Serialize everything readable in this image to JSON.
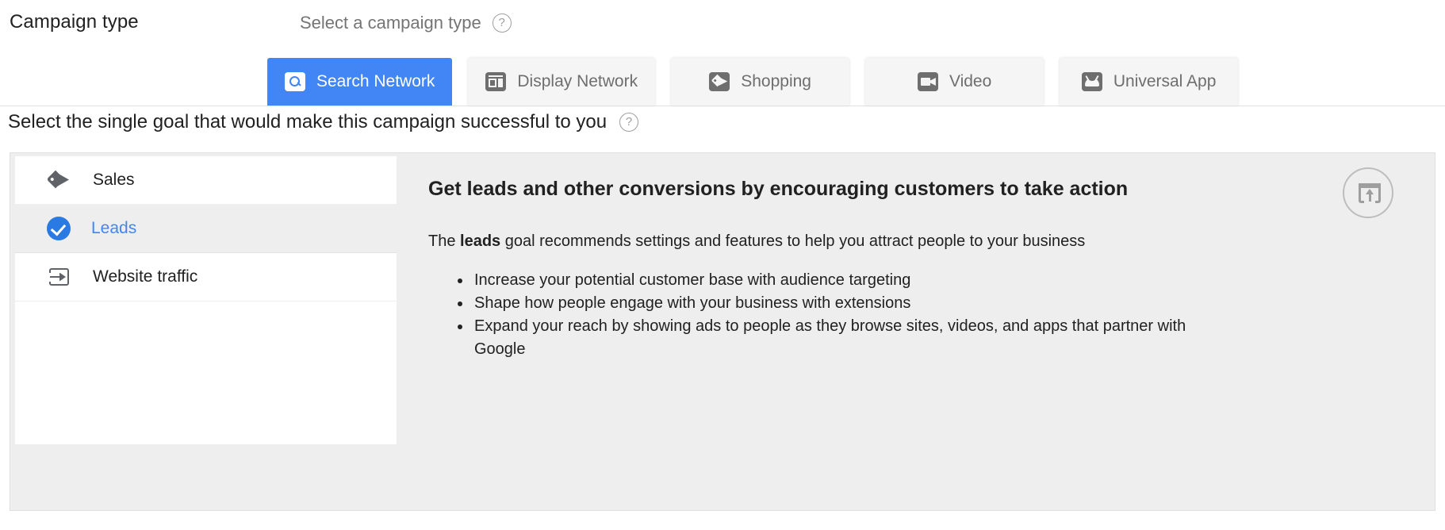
{
  "campaign_type": {
    "label": "Campaign type",
    "subtitle": "Select a campaign type",
    "help_icon": "help-circle-icon",
    "tabs": [
      {
        "label": "Search Network",
        "icon": "search-icon",
        "active": true
      },
      {
        "label": "Display Network",
        "icon": "display-network-icon",
        "active": false
      },
      {
        "label": "Shopping",
        "icon": "price-tag-icon",
        "active": false
      },
      {
        "label": "Video",
        "icon": "video-camera-icon",
        "active": false
      },
      {
        "label": "Universal App",
        "icon": "android-app-icon",
        "active": false
      }
    ],
    "active_tab_color": "#4285f4",
    "inactive_tab_color": "#f5f5f5"
  },
  "goal": {
    "heading": "Select the single goal that would make this campaign successful to you",
    "help_icon": "help-circle-icon",
    "items": [
      {
        "label": "Sales",
        "icon": "price-tag-icon",
        "selected": false
      },
      {
        "label": "Leads",
        "icon": "check-circle-icon",
        "selected": true
      },
      {
        "label": "Website traffic",
        "icon": "arrow-into-box-icon",
        "selected": false
      }
    ],
    "selected_color": "#4285f4",
    "detail": {
      "title": "Get leads and other conversions by encouraging customers to take action",
      "intro_before": "The ",
      "intro_bold": "leads",
      "intro_after": " goal recommends settings and features to help you attract people to your business",
      "bullets": [
        "Increase your potential customer base with audience targeting",
        "Shape how people engage with your business with extensions",
        "Expand your reach by showing ads to people as they browse sites, videos, and apps that partner with Google"
      ],
      "launch_icon": "launch-open-in-new-icon"
    }
  }
}
